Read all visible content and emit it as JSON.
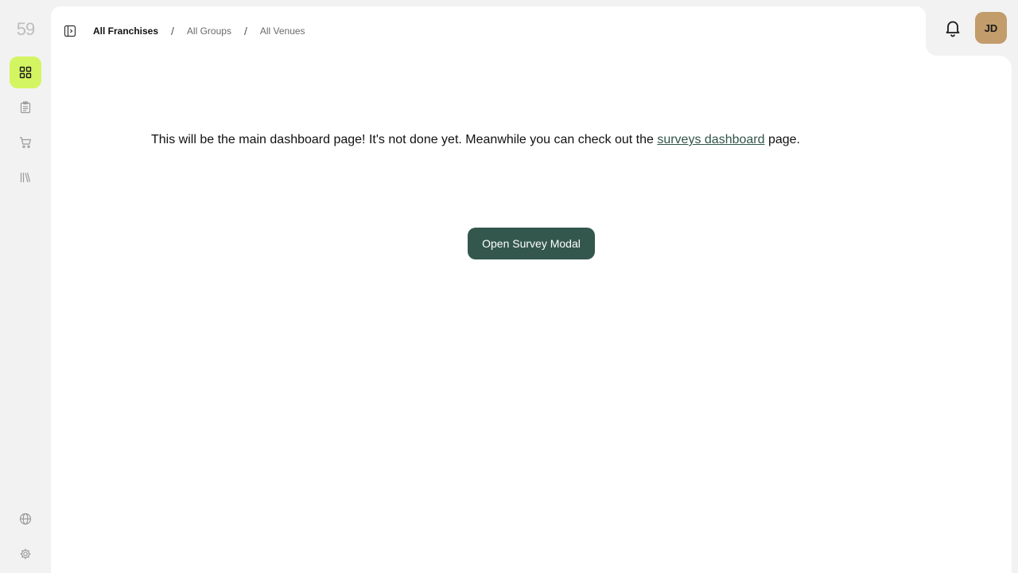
{
  "logo": {
    "text": "59"
  },
  "sidebar": {
    "items": [
      {
        "name": "dashboard",
        "icon": "dashboard-icon",
        "active": true
      },
      {
        "name": "surveys",
        "icon": "clipboard-icon",
        "active": false
      },
      {
        "name": "orders",
        "icon": "cart-icon",
        "active": false
      },
      {
        "name": "library",
        "icon": "library-icon",
        "active": false
      }
    ],
    "bottom": [
      {
        "name": "language",
        "icon": "globe-icon"
      },
      {
        "name": "settings",
        "icon": "gear-icon"
      }
    ]
  },
  "breadcrumb": {
    "items": [
      "All Franchises",
      "All Groups",
      "All Venues"
    ],
    "separator": "/"
  },
  "header": {
    "avatar_initials": "JD",
    "avatar_color": "#c29c6b"
  },
  "main": {
    "intro_before": "This will be the main dashboard page! It's not done yet. Meanwhile you can check out the ",
    "intro_link": "surveys dashboard",
    "intro_after": " page.",
    "cta_label": "Open Survey Modal"
  },
  "colors": {
    "accent": "#d4f562",
    "primary": "#33574d",
    "link": "#315449"
  }
}
